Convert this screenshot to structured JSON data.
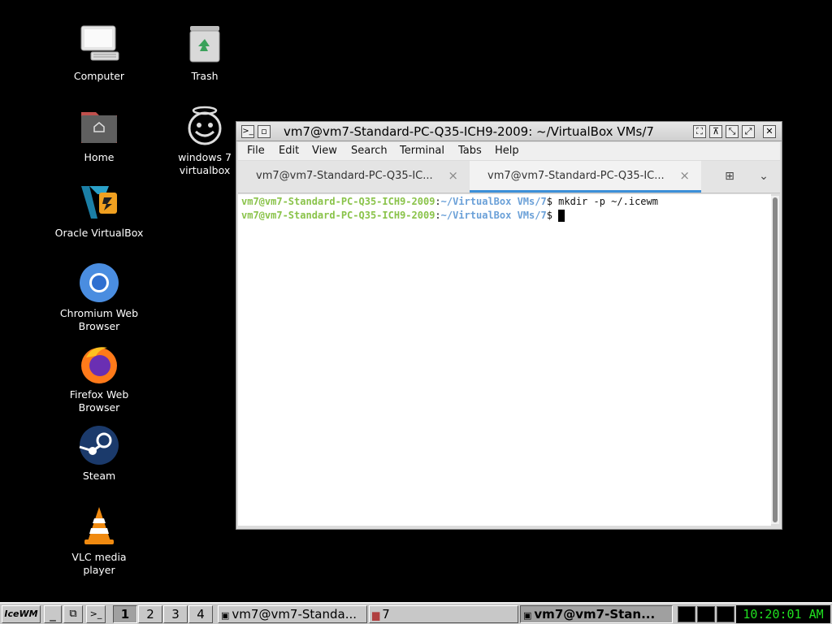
{
  "desktop": {
    "icons": [
      {
        "label": "Computer",
        "icon": "computer-icon"
      },
      {
        "label": "Trash",
        "icon": "trash-icon"
      },
      {
        "label": "Home",
        "icon": "home-folder-icon"
      },
      {
        "label": "windows 7\nvirtualbox",
        "icon": "smiley-halo-icon"
      },
      {
        "label": "Oracle VirtualBox",
        "icon": "virtualbox-icon"
      },
      {
        "label": "Chromium Web\nBrowser",
        "icon": "chromium-icon"
      },
      {
        "label": "Firefox Web\nBrowser",
        "icon": "firefox-icon"
      },
      {
        "label": "Steam",
        "icon": "steam-icon"
      },
      {
        "label": "VLC media player",
        "icon": "vlc-icon"
      }
    ]
  },
  "window": {
    "title": "vm7@vm7-Standard-PC-Q35-ICH9-2009: ~/VirtualBox VMs/7",
    "menu": [
      "File",
      "Edit",
      "View",
      "Search",
      "Terminal",
      "Tabs",
      "Help"
    ],
    "tabs": [
      {
        "label": "vm7@vm7-Standard-PC-Q35-IC...",
        "active": false
      },
      {
        "label": "vm7@vm7-Standard-PC-Q35-IC...",
        "active": true
      }
    ],
    "close_glyph": "×",
    "terminal": {
      "lines": [
        {
          "user": "vm7@vm7-Standard-PC-Q35-ICH9-2009",
          "sep": ":",
          "path": "~/VirtualBox VMs/7",
          "prompt": "$ ",
          "cmd": "mkdir -p ~/.icewm"
        },
        {
          "user": "vm7@vm7-Standard-PC-Q35-ICH9-2009",
          "sep": ":",
          "path": "~/VirtualBox VMs/7",
          "prompt": "$ ",
          "cmd": ""
        }
      ]
    }
  },
  "taskbar": {
    "start_label": "IceWM",
    "workspaces": [
      "1",
      "2",
      "3",
      "4"
    ],
    "tasks": [
      {
        "label": "vm7@vm7-Standa...",
        "icon": "terminal-icon"
      },
      {
        "label": "7",
        "icon": "folder-icon"
      },
      {
        "label": "vm7@vm7-Stan...",
        "icon": "terminal-icon"
      }
    ],
    "clock": "10:20:01 AM"
  },
  "colors": {
    "prompt_user": "#8ac34a",
    "prompt_path": "#6aa0d8",
    "clock_text": "#20e020",
    "active_tab_underline": "#3b8fd8"
  }
}
